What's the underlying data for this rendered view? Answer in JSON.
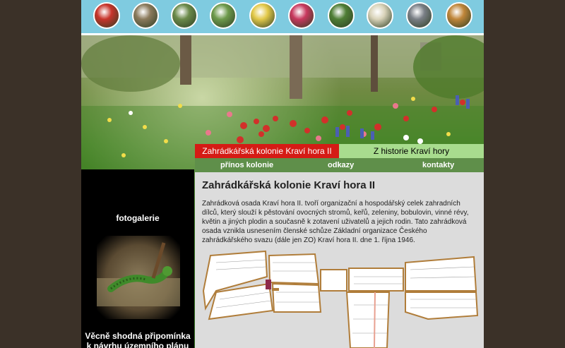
{
  "header": {
    "thumbnails": [
      {
        "name": "red-flower-thumbnail",
        "color": "#c8342b"
      },
      {
        "name": "people-thumbnail",
        "color": "#8b7a5c"
      },
      {
        "name": "group-thumbnail",
        "color": "#6b8a4a"
      },
      {
        "name": "garden-path-thumbnail",
        "color": "#6e9a4c"
      },
      {
        "name": "yellow-flower-thumbnail",
        "color": "#e3c94a"
      },
      {
        "name": "pink-flower-thumbnail",
        "color": "#c8385e"
      },
      {
        "name": "tree-thumbnail",
        "color": "#4f7e36"
      },
      {
        "name": "white-flower-thumbnail",
        "color": "#d9d3b9"
      },
      {
        "name": "crowd-thumbnail",
        "color": "#7a7f86"
      },
      {
        "name": "vegetables-thumbnail",
        "color": "#c0863a"
      }
    ]
  },
  "tabs": {
    "active": "Zahrádkářská kolonie Kraví hora II",
    "history": "Z historie Kraví hory"
  },
  "subnav": {
    "contribution": "přínos kolonie",
    "links": "odkazy",
    "contacts": "kontakty"
  },
  "sidebar": {
    "gallery_title": "fotogalerie",
    "notice_line1": "Věcně shodná připomínka",
    "notice_line2": "k návrhu územního plánu"
  },
  "main": {
    "title": "Zahrádkářská kolonie Kraví hora II",
    "paragraph": "Zahrádková osada Kraví hora II. tvoří organizační a hospodářský celek zahradních dílců, který slouží k pěstování ovocných stromů, keřů, zeleniny, bobulovin, vinné révy, květin a jiných plodin a současně k zotavení uživatelů a jejich rodin. Tato zahrádková osada vznikla usnesením členské schůze Základní organizace Českého zahrádkářského svazu (dále jen ZO) Kraví hora II. dne 1. října 1946."
  },
  "colors": {
    "background": "#3b3128",
    "topbar": "#7fcbe0",
    "tab_active": "#d51b15",
    "tab_other": "#a8dc8e",
    "subnav": "#5f8f4a",
    "content_bg": "#dcdcdc"
  }
}
